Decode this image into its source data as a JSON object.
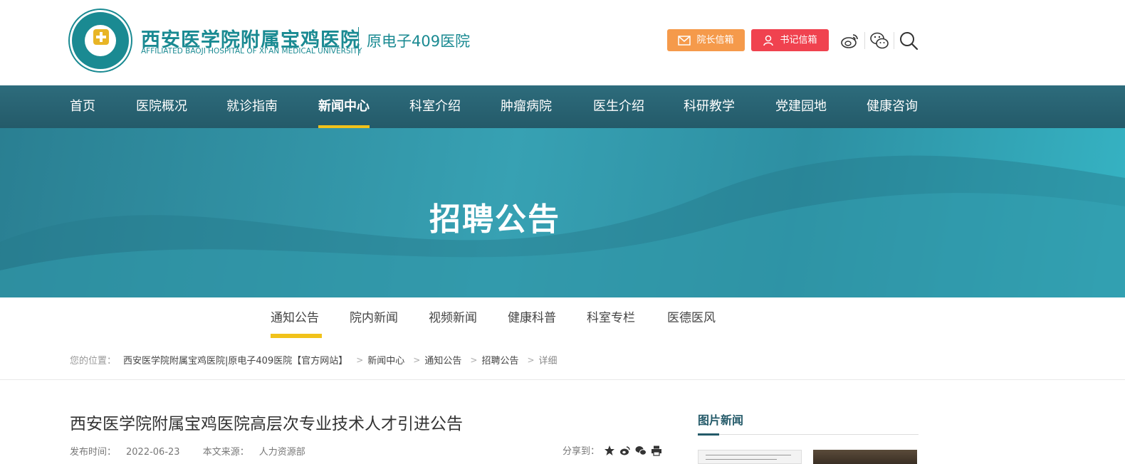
{
  "header": {
    "logo_name": "西安医学院附属宝鸡医院",
    "logo_en": "AFFILIATED BAOJI HOSPITAL OF XI'AN MEDICAL UNIVERSITY",
    "logo_sub": "原电子409医院",
    "president_mailbox": "院长信箱",
    "secretary_mailbox": "书记信箱",
    "icons": [
      "weibo-icon",
      "wechat-icon",
      "search-icon"
    ],
    "colors": {
      "president": "#f59a4b",
      "secretary": "#f0424f",
      "brand": "#1a8a92"
    }
  },
  "nav": {
    "items": [
      {
        "label": "首页"
      },
      {
        "label": "医院概况"
      },
      {
        "label": "就诊指南"
      },
      {
        "label": "新闻中心"
      },
      {
        "label": "科室介绍"
      },
      {
        "label": "肿瘤病院"
      },
      {
        "label": "医生介绍"
      },
      {
        "label": "科研教学"
      },
      {
        "label": "党建园地"
      },
      {
        "label": "健康咨询"
      }
    ],
    "active": "新闻中心"
  },
  "banner": {
    "title": "招聘公告"
  },
  "subnav": {
    "items": [
      {
        "label": "通知公告"
      },
      {
        "label": "院内新闻"
      },
      {
        "label": "视频新闻"
      },
      {
        "label": "健康科普"
      },
      {
        "label": "科室专栏"
      },
      {
        "label": "医德医风"
      }
    ],
    "active": "通知公告"
  },
  "breadcrumb": {
    "prefix": "您的位置：",
    "items": [
      "西安医学院附属宝鸡医院|原电子409医院【官方网站】",
      "新闻中心",
      "通知公告",
      "招聘公告"
    ],
    "last": "详细"
  },
  "article": {
    "title": "西安医学院附属宝鸡医院高层次专业技术人才引进公告",
    "publish_label": "发布时间：",
    "publish_date": "2022-06-23",
    "source_label": "本文来源：",
    "source": "人力资源部",
    "share_label": "分享到："
  },
  "side": {
    "title": "图片新闻"
  }
}
